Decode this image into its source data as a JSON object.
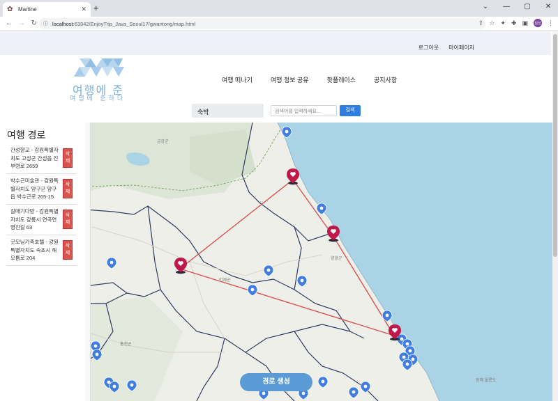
{
  "browser": {
    "tab_title": "Martine",
    "new_tab": "+",
    "url_host": "localhost",
    "url_path": ":63342/EnjoyTrip_Java_Seoul17/gwantong/map.html",
    "avatar_label": "임전"
  },
  "header": {
    "links": [
      "로그아웃",
      "마이페이지"
    ],
    "logo_title": "여행에 준",
    "logo_sub": "여행에 준하다",
    "nav": [
      "여행 떠나기",
      "여행 정보 공유",
      "핫플레이스",
      "공지사항"
    ]
  },
  "search": {
    "category": "숙박",
    "placeholder": "검색어를 입력하세요...",
    "button": "검색"
  },
  "sidebar": {
    "title": "여행 경로",
    "delete_label": "삭제",
    "routes": [
      "간성향교 - 강원특별자치도 고성군 간성읍 진부령로 2659",
      "박수근미술관 - 강원특별자치도 양구군 양구읍 박수근로 265-15",
      "갈매기다방 - 강원특별자치도 강릉시 연곡면 영진길 63",
      "굿모닝가족호텔 - 강원특별자치도 속초시 해오름로 204"
    ]
  },
  "map": {
    "generate_button": "경로 생성",
    "labels": [
      "금강군",
      "인제군",
      "양양군",
      "홍천군",
      "동해 울릉도"
    ],
    "colors": {
      "land": "#eeefe8",
      "sea": "#aad3e6",
      "route": "#d9534f",
      "pin_blue": "#3f7ee0",
      "pin_red": "#c0184a"
    }
  }
}
